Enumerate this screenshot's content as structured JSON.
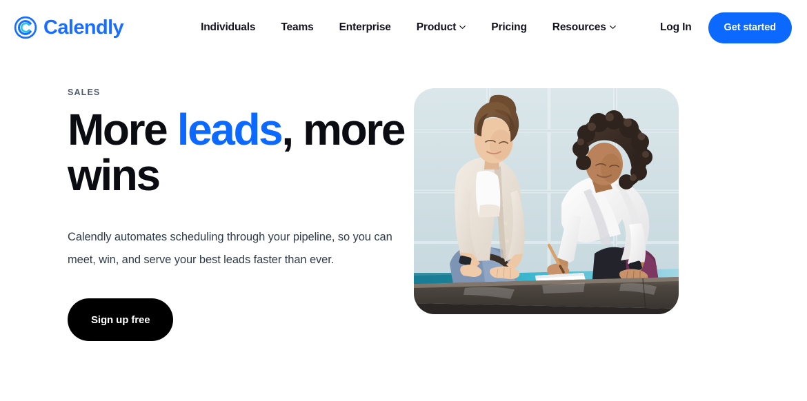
{
  "brand": {
    "name": "Calendly",
    "logo_icon": "calendly-circle-c-icon",
    "color": "#1a6eff"
  },
  "header": {
    "nav": [
      {
        "label": "Individuals",
        "has_dropdown": false
      },
      {
        "label": "Teams",
        "has_dropdown": false
      },
      {
        "label": "Enterprise",
        "has_dropdown": false
      },
      {
        "label": "Product",
        "has_dropdown": true
      },
      {
        "label": "Pricing",
        "has_dropdown": false
      },
      {
        "label": "Resources",
        "has_dropdown": true
      }
    ],
    "login_label": "Log In",
    "get_started_label": "Get started",
    "get_started_color": "#0b69ff"
  },
  "hero": {
    "eyebrow": "SALES",
    "title_part1": "More ",
    "title_highlight": "leads",
    "title_part2": ", more wins",
    "highlight_color": "#0b69ff",
    "subtitle": "Calendly automates scheduling through your pipeline, so you can meet, win, and serve your best leads faster than ever.",
    "cta_label": "Sign up free",
    "cta_color": "#000000",
    "image_alt": "two-women-working-at-desk-photo"
  }
}
